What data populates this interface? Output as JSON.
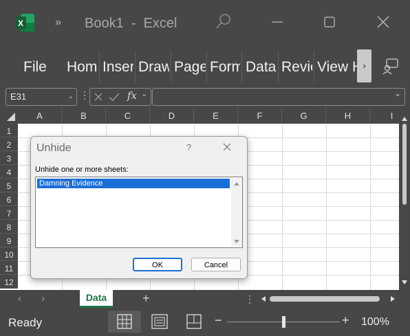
{
  "window": {
    "title": "Book1  -  Excel",
    "icons": [
      "excel-logo",
      "more-commands-chevrons",
      "search-icon",
      "minimize-icon",
      "maximize-icon",
      "close-icon"
    ]
  },
  "ribbon": {
    "tabs": [
      "File",
      "Hom",
      "Inser",
      "Draw",
      "Page",
      "Form",
      "Data",
      "Revie",
      "View",
      "H"
    ],
    "scroll_glyph": "›",
    "right_icon": "share-icon"
  },
  "formula_bar": {
    "name_box": "E31",
    "fx_label": "fx",
    "formula_value": ""
  },
  "grid": {
    "columns": [
      "A",
      "B",
      "C",
      "D",
      "E",
      "F",
      "G",
      "H",
      "I"
    ],
    "rows": [
      "1",
      "2",
      "3",
      "4",
      "5",
      "6",
      "7",
      "8",
      "9",
      "10",
      "11",
      "12"
    ]
  },
  "sheets": {
    "active_tab": "Data",
    "add_label": "+"
  },
  "status": {
    "text": "Ready",
    "zoom": "100%",
    "zoom_fraction": 0.5,
    "zoom_minus": "−",
    "zoom_plus": "+"
  },
  "dialog": {
    "title": "Unhide",
    "help": "?",
    "instruction": "Unhide one or more sheets:",
    "hidden_sheets": [
      "Damning Evidence"
    ],
    "ok_label": "OK",
    "cancel_label": "Cancel"
  },
  "colors": {
    "chrome": "#474747",
    "selection": "#1a6fd6",
    "excel_green": "#217346"
  }
}
